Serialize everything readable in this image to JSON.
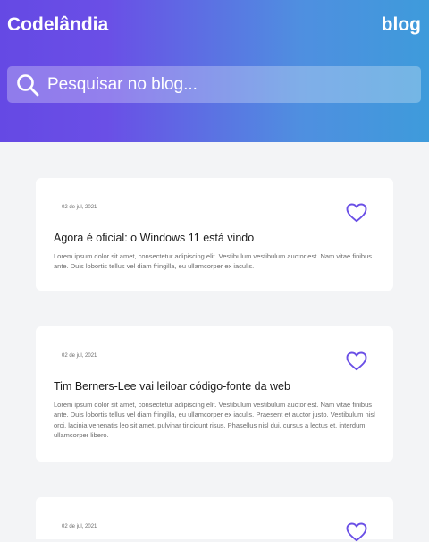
{
  "header": {
    "brand": "Codelândia",
    "nav_link": "blog",
    "search": {
      "placeholder": "Pesquisar no blog..."
    },
    "gradient_colors": [
      "#6549e4",
      "#3e9bdb"
    ]
  },
  "accent_color": "#6a4fe6",
  "posts": [
    {
      "date": "02 de jul, 2021",
      "title": "Agora é oficial: o Windows 11 está vindo",
      "excerpt": "Lorem ipsum dolor sit amet, consectetur adipiscing elit. Vestibulum vestibulum auctor est. Nam vitae finibus ante. Duis lobortis tellus vel diam fringilla, eu ullamcorper ex iaculis.",
      "icon": "heart-icon"
    },
    {
      "date": "02 de jul, 2021",
      "title": "Tim Berners-Lee vai leiloar código-fonte da web",
      "excerpt": "Lorem ipsum dolor sit amet, consectetur adipiscing elit. Vestibulum vestibulum auctor est. Nam vitae finibus ante. Duis lobortis tellus vel diam fringilla, eu ullamcorper ex iaculis. Praesent et auctor justo. Vestibulum nisl orci, lacinia venenatis leo sit amet, pulvinar tincidunt risus. Phasellus nisl dui, cursus a lectus et, interdum ullamcorper libero.",
      "icon": "heart-icon"
    },
    {
      "date": "02 de jul, 2021",
      "icon": "heart-icon"
    }
  ]
}
